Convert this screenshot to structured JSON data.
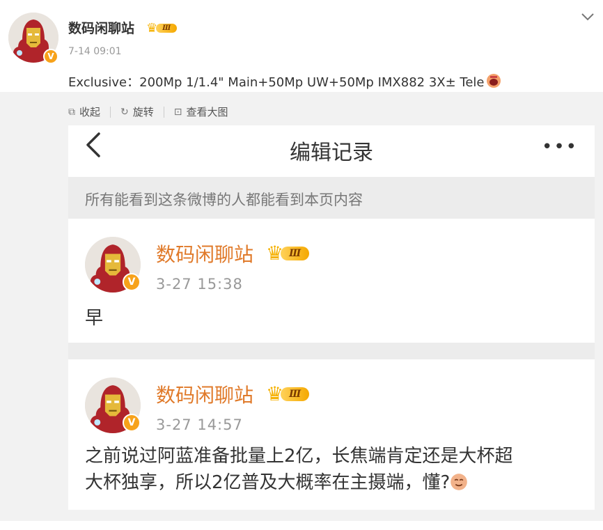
{
  "post": {
    "author": "数码闲聊站",
    "level_badge": "Ⅲ",
    "verified_badge": "V",
    "time": "7-14 09:01",
    "text": "Exclusive：200Mp 1/1.4\" Main+50Mp UW+50Mp IMX882 3X± Tele",
    "more_icon": "chevron-down-icon"
  },
  "media_actions": {
    "collapse": "收起",
    "rotate": "旋转",
    "view_large": "查看大图"
  },
  "screenshot": {
    "title": "编辑记录",
    "back_icon": "‹",
    "more_icon": "•••",
    "notice": "所有能看到这条微博的人都能看到本页内容",
    "entries": [
      {
        "author": "数码闲聊站",
        "level_badge": "Ⅲ",
        "verified_badge": "V",
        "time": "3-27 15:38",
        "text": "早"
      },
      {
        "author": "数码闲聊站",
        "level_badge": "Ⅲ",
        "verified_badge": "V",
        "time": "3-27 14:57",
        "text_line1": "之前说过阿蓝准备批量上2亿，长焦端肯定还是大杯超",
        "text_line2": "大杯独享，所以2亿普及大概率在主摄端，懂?"
      }
    ]
  },
  "colors": {
    "accent_orange": "#e07a2a",
    "verified": "#f7a21a",
    "crown": "#f5b100",
    "gray_bg": "#f2f2f2"
  }
}
